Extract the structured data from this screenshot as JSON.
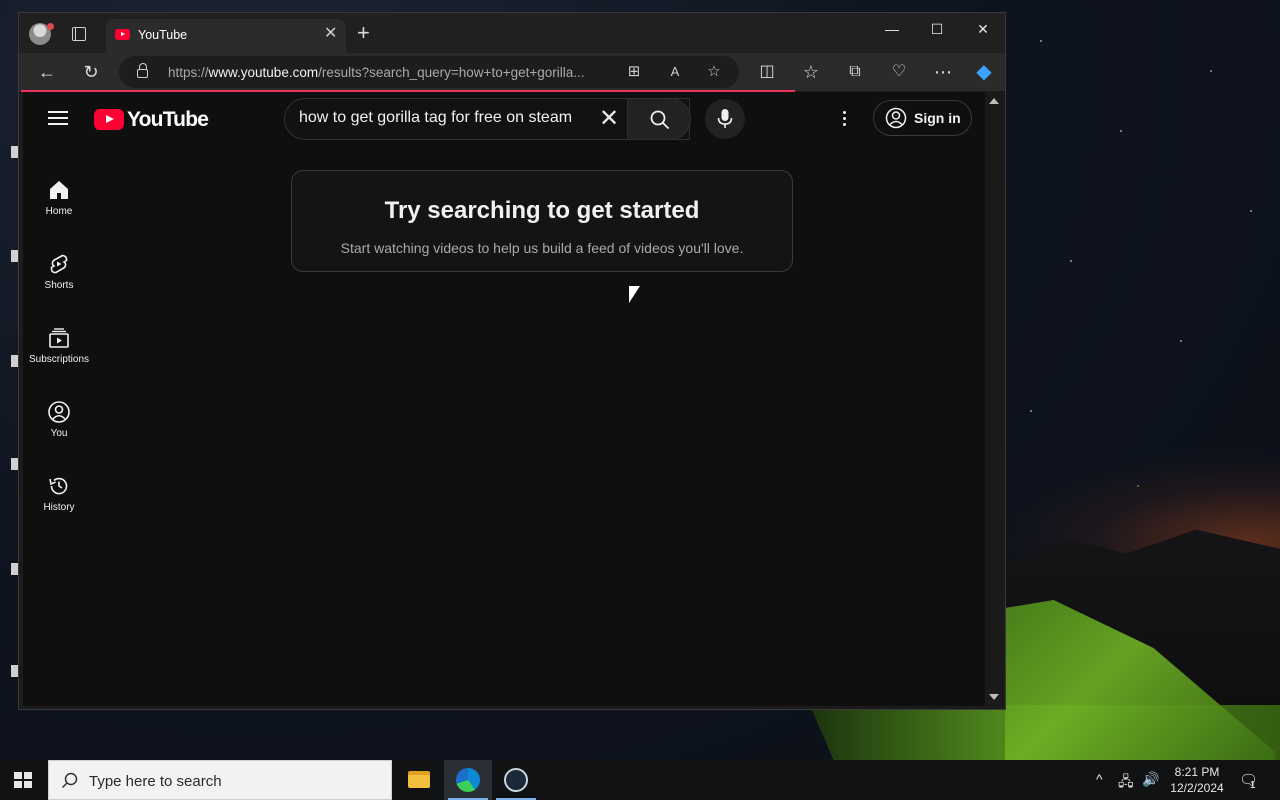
{
  "browser": {
    "tab_title": "YouTube",
    "url_prefix": "https://",
    "url_host": "www.youtube.com",
    "url_path": "/results?search_query=how+to+get+gorilla..."
  },
  "youtube": {
    "logo_text": "YouTube",
    "search_value": "how to get gorilla tag for free on steam",
    "sign_in_label": "Sign in",
    "guide": [
      {
        "label": "Home"
      },
      {
        "label": "Shorts"
      },
      {
        "label": "Subscriptions"
      },
      {
        "label": "You"
      },
      {
        "label": "History"
      }
    ],
    "promo_title": "Try searching to get started",
    "promo_subtitle": "Start watching videos to help us build a feed of videos you'll love."
  },
  "taskbar": {
    "search_placeholder": "Type here to search",
    "time": "8:21 PM",
    "date": "12/2/2024",
    "notification_count": "1"
  },
  "colors": {
    "yt_red": "#ff0033",
    "yt_background": "#0f0f0f",
    "edge_progress": "#e8335a"
  }
}
